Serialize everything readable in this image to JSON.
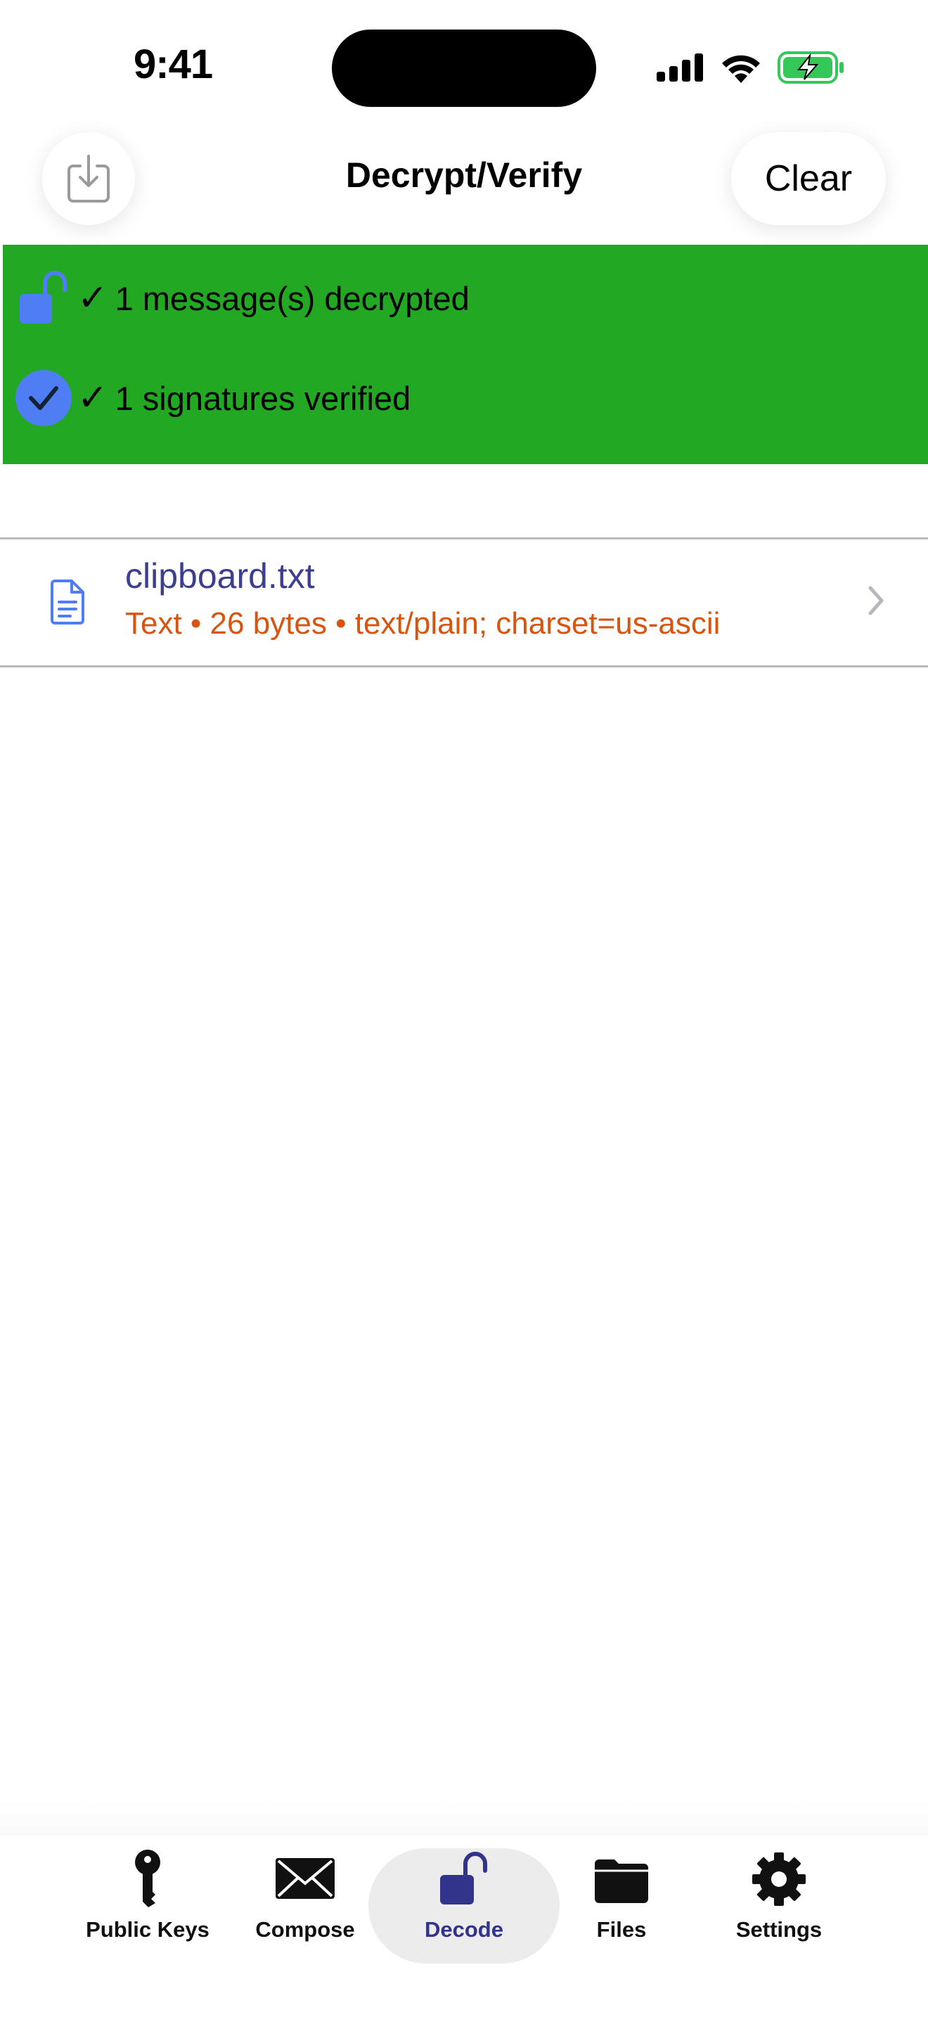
{
  "status_bar": {
    "time": "9:41"
  },
  "nav": {
    "title": "Decrypt/Verify",
    "clear_label": "Clear"
  },
  "banner": {
    "color": "#22a823",
    "decrypted": {
      "check": "✓",
      "text": "1 message(s) decrypted"
    },
    "verified": {
      "check": "✓",
      "text": "1 signatures verified"
    }
  },
  "files": [
    {
      "name": "clipboard.txt",
      "meta": "Text • 26 bytes • text/plain; charset=us-ascii"
    }
  ],
  "tabs": [
    {
      "label": "Public Keys",
      "icon": "key-icon"
    },
    {
      "label": "Compose",
      "icon": "envelope-icon"
    },
    {
      "label": "Decode",
      "icon": "unlock-icon",
      "active": true
    },
    {
      "label": "Files",
      "icon": "folder-icon"
    },
    {
      "label": "Settings",
      "icon": "gear-icon"
    }
  ],
  "colors": {
    "accent": "#32338a",
    "icon_blue": "#4f7df3",
    "meta_orange": "#d9540f",
    "battery_green": "#34c759"
  }
}
